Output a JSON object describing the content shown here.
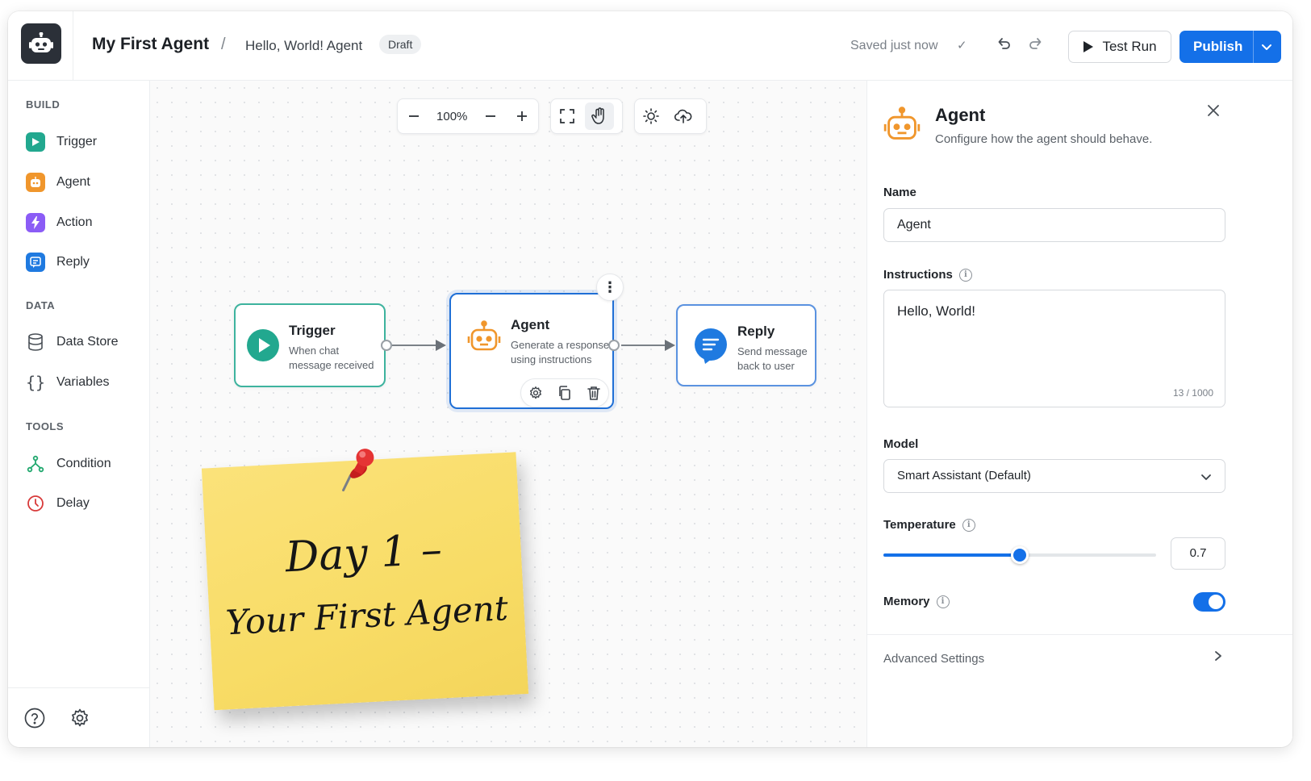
{
  "header": {
    "title": "My First Agent",
    "separator": "/",
    "breadcrumb": "Hello, World! Agent",
    "status_badge": "Draft",
    "saved_status": "Saved just now",
    "test_run_label": "Test Run",
    "publish_label": "Publish"
  },
  "sidebar": {
    "build_title": "BUILD",
    "build_items": [
      {
        "label": "Trigger",
        "icon": "play-icon",
        "color": "#22a88f"
      },
      {
        "label": "Agent",
        "icon": "robot-icon",
        "color": "#f0962c"
      },
      {
        "label": "Action",
        "icon": "lightning-icon",
        "color": "#8b5cf6"
      },
      {
        "label": "Reply",
        "icon": "chat-icon",
        "color": "#1f7ae0"
      }
    ],
    "data_title": "DATA",
    "data_items": [
      {
        "label": "Data Store",
        "icon": "database-icon"
      },
      {
        "label": "Variables",
        "icon": "braces-icon"
      }
    ],
    "tools_title": "TOOLS",
    "tools_items": [
      {
        "label": "Condition",
        "icon": "branch-icon",
        "color": "#22a86f"
      },
      {
        "label": "Delay",
        "icon": "clock-icon",
        "color": "#d83a3a"
      }
    ]
  },
  "canvas": {
    "zoom": "100%",
    "nodes": {
      "trigger": {
        "title": "Trigger",
        "line1": "When chat",
        "line2": "message received",
        "accent": "#22a88f"
      },
      "agent": {
        "title": "Agent",
        "line1": "Generate a response",
        "line2": "using instructions",
        "accent": "#1f6fd6"
      },
      "reply": {
        "title": "Reply",
        "line1": "Send message",
        "line2": "back to user",
        "accent": "#1f7ae0"
      }
    },
    "sticky_note": {
      "line1": "Day 1 –",
      "line2": "Your First Agent"
    }
  },
  "panel": {
    "title": "Agent",
    "subtitle": "Configure how the agent should behave.",
    "name_label": "Name",
    "name_value": "Agent",
    "instructions_label": "Instructions",
    "instructions_value": "Hello, World!",
    "instructions_count": "13 / 1000",
    "model_label": "Model",
    "model_value": "Smart Assistant (Default)",
    "temperature_label": "Temperature",
    "temperature_value": "0.7",
    "temperature_fraction": 0.5,
    "memory_label": "Memory",
    "memory_enabled": true,
    "advanced_label": "Advanced Settings"
  },
  "colors": {
    "accent": "#1470e8",
    "agent_orange": "#f0962c",
    "trigger_teal": "#22a88f"
  }
}
